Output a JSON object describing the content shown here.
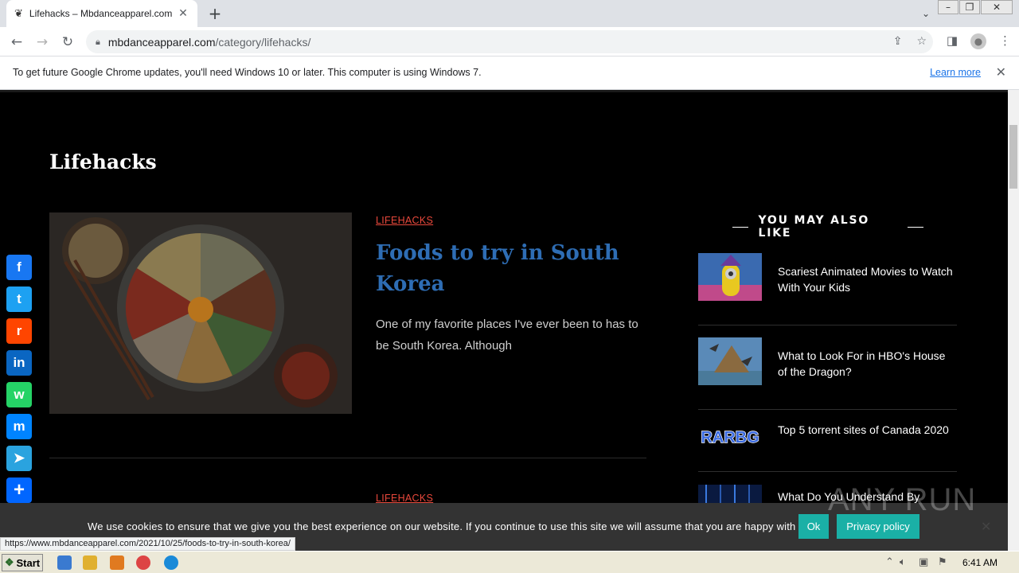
{
  "browser": {
    "tab_title": "Lifehacks – Mbdanceapparel.com",
    "url_domain": "mbdanceapparel.com",
    "url_path": "/category/lifehacks/",
    "infobar_text": "To get future Google Chrome updates, you'll need Windows 10 or later. This computer is using Windows 7.",
    "infobar_link": "Learn more",
    "status_url": "https://www.mbdanceapparel.com/2021/10/25/foods-to-try-in-south-korea/"
  },
  "page": {
    "category_title": "Lifehacks",
    "posts": [
      {
        "tag": "LIFEHACKS",
        "title": "Foods to try in South Korea",
        "excerpt": "One of my favorite places I've ever been to has to be South Korea. Although"
      },
      {
        "tag": "LIFEHACKS"
      }
    ],
    "sidebar": {
      "heading": "YOU MAY ALSO LIKE",
      "items": [
        {
          "title": "Scariest Animated Movies to Watch With Your Kids"
        },
        {
          "title": "What to Look For in HBO's House of the Dragon?"
        },
        {
          "title": "Top 5 torrent sites of Canada 2020",
          "thumb_text": "RARBG"
        },
        {
          "title": "What Do You Understand By"
        }
      ]
    },
    "share_buttons": [
      {
        "name": "facebook",
        "glyph": "f",
        "color": "#1877f2"
      },
      {
        "name": "twitter",
        "glyph": "t",
        "color": "#1da1f2"
      },
      {
        "name": "reddit",
        "glyph": "r",
        "color": "#ff4500"
      },
      {
        "name": "linkedin",
        "glyph": "in",
        "color": "#0a66c2"
      },
      {
        "name": "whatsapp",
        "glyph": "w",
        "color": "#25d366"
      },
      {
        "name": "messenger",
        "glyph": "m",
        "color": "#0084ff"
      },
      {
        "name": "telegram",
        "glyph": "➤",
        "color": "#2aa3df"
      },
      {
        "name": "share",
        "glyph": "+",
        "color": "#0166ff"
      }
    ]
  },
  "cookie": {
    "text": "We use cookies to ensure that we give you the best experience on our website. If you continue to use this site we will assume that you are happy with it.",
    "ok": "Ok",
    "privacy": "Privacy policy"
  },
  "watermark": "ANY RUN",
  "taskbar": {
    "start": "Start",
    "clock": "6:41 AM"
  }
}
